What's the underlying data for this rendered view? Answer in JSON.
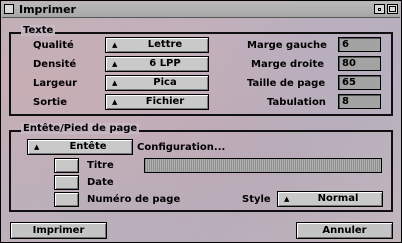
{
  "window": {
    "title": "Imprimer"
  },
  "texte": {
    "legend": "Texte",
    "rows": [
      {
        "label": "Qualité",
        "value": "Lettre"
      },
      {
        "label": "Densité",
        "value": "6 LPP"
      },
      {
        "label": "Largeur",
        "value": "Pica"
      },
      {
        "label": "Sortie",
        "value": "Fichier"
      }
    ],
    "fields": [
      {
        "label": "Marge gauche",
        "value": "6"
      },
      {
        "label": "Marge droite",
        "value": "80"
      },
      {
        "label": "Taille de page",
        "value": "65"
      },
      {
        "label": "Tabulation",
        "value": "8"
      }
    ]
  },
  "header_footer": {
    "legend": "Entête/Pied de page",
    "selector": "Entête",
    "config_label": "Configuration...",
    "config_value": "",
    "checks": [
      {
        "label": "Titre",
        "checked": false
      },
      {
        "label": "Date",
        "checked": false
      },
      {
        "label": "Numéro de page",
        "checked": false
      }
    ],
    "style_label": "Style",
    "style_value": "Normal"
  },
  "actions": {
    "print": "Imprimer",
    "cancel": "Annuler"
  }
}
